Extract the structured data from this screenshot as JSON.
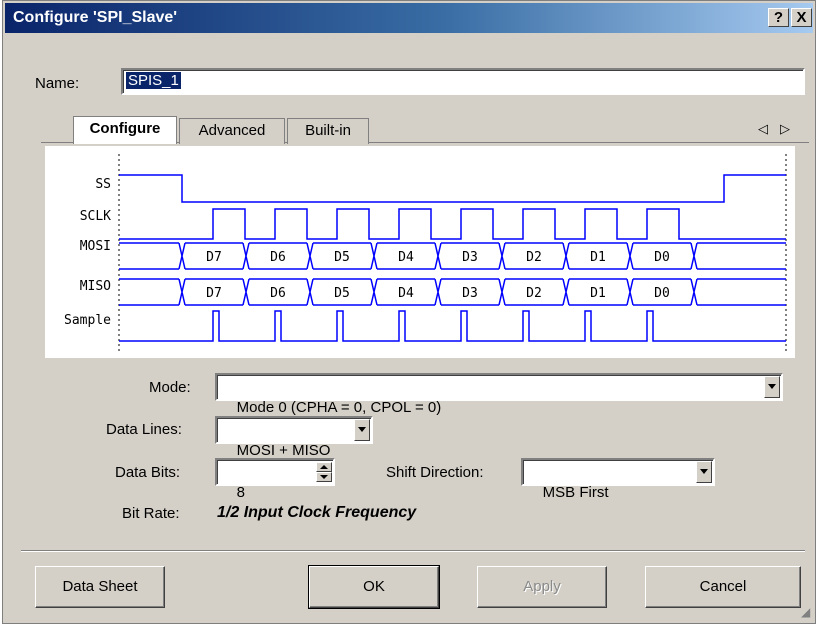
{
  "window": {
    "title": "Configure 'SPI_Slave'",
    "help_label": "?",
    "close_label": "X"
  },
  "name_field": {
    "label": "Name:",
    "value": "SPIS_1"
  },
  "tabs": [
    {
      "label": "Configure",
      "active": true
    },
    {
      "label": "Advanced",
      "active": false
    },
    {
      "label": "Built-in",
      "active": false
    }
  ],
  "tab_scroll": {
    "left": "◁",
    "right": "▷"
  },
  "timing_diagram": {
    "signals": [
      "SS",
      "SCLK",
      "MOSI",
      "MISO",
      "Sample"
    ],
    "mosi_bits": [
      "D7",
      "D6",
      "D5",
      "D4",
      "D3",
      "D2",
      "D1",
      "D0"
    ],
    "miso_bits": [
      "D7",
      "D6",
      "D5",
      "D4",
      "D3",
      "D2",
      "D1",
      "D0"
    ],
    "colors": {
      "signal": "#0000ff",
      "guide": "#000000"
    }
  },
  "form": {
    "mode_label": "Mode:",
    "mode_value": "Mode 0 (CPHA = 0, CPOL = 0)",
    "data_lines_label": "Data Lines:",
    "data_lines_value": "MOSI + MISO",
    "data_bits_label": "Data Bits:",
    "data_bits_value": "8",
    "shift_direction_label": "Shift Direction:",
    "shift_direction_value": "MSB First",
    "bit_rate_label": "Bit Rate:",
    "bit_rate_value": "1/2 Input Clock Frequency"
  },
  "buttons": {
    "data_sheet": "Data Sheet",
    "ok": "OK",
    "apply": "Apply",
    "cancel": "Cancel"
  }
}
